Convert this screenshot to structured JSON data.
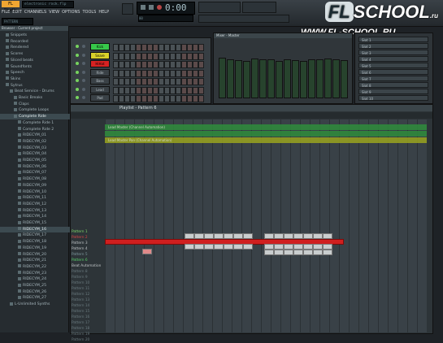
{
  "app": {
    "title": "FL Studio",
    "project_name": "electronic rock.flp",
    "time_display": "0:00",
    "time_sub": "00",
    "hint_label": "PATTERN"
  },
  "menu": [
    "FILE",
    "EDIT",
    "CHANNELS",
    "VIEW",
    "OPTIONS",
    "TOOLS",
    "HELP"
  ],
  "logo": {
    "fl": "FL",
    "school": "SCHOOL",
    "domain_suffix": ".ru",
    "url": "WWW.FL-SCHOOL.RU"
  },
  "browser": {
    "title": "Browser - Current project",
    "items": [
      {
        "label": "Snippets",
        "indent": 1
      },
      {
        "label": "Recorded",
        "indent": 1
      },
      {
        "label": "Rendered",
        "indent": 1
      },
      {
        "label": "Scores",
        "indent": 1
      },
      {
        "label": "Sliced beats",
        "indent": 1
      },
      {
        "label": "Soundfonts",
        "indent": 1
      },
      {
        "label": "Speech",
        "indent": 1
      },
      {
        "label": "Skins",
        "indent": 1
      },
      {
        "label": "Sytrus",
        "indent": 1
      },
      {
        "label": "Beat Service - Drums",
        "indent": 2
      },
      {
        "label": "Basic Breaks",
        "indent": 3
      },
      {
        "label": "Claps",
        "indent": 3
      },
      {
        "label": "Complete Loops",
        "indent": 3
      },
      {
        "label": "Complete Ride",
        "indent": 3,
        "selected": true
      },
      {
        "label": "Complete Ride 1",
        "indent": 4
      },
      {
        "label": "Complete Ride 2",
        "indent": 4
      },
      {
        "label": "RIDECYM_01",
        "indent": 4
      },
      {
        "label": "RIDECYM_02",
        "indent": 4
      },
      {
        "label": "RIDECYM_03",
        "indent": 4
      },
      {
        "label": "RIDECYM_04",
        "indent": 4
      },
      {
        "label": "RIDECYM_05",
        "indent": 4
      },
      {
        "label": "RIDECYM_06",
        "indent": 4
      },
      {
        "label": "RIDECYM_07",
        "indent": 4
      },
      {
        "label": "RIDECYM_08",
        "indent": 4
      },
      {
        "label": "RIDECYM_09",
        "indent": 4
      },
      {
        "label": "RIDECYM_10",
        "indent": 4
      },
      {
        "label": "RIDECYM_11",
        "indent": 4
      },
      {
        "label": "RIDECYM_12",
        "indent": 4
      },
      {
        "label": "RIDECYM_13",
        "indent": 4
      },
      {
        "label": "RIDECYM_14",
        "indent": 4
      },
      {
        "label": "RIDECYM_15",
        "indent": 4
      },
      {
        "label": "RIDECYM_16",
        "indent": 4,
        "selected": true
      },
      {
        "label": "RIDECYM_17",
        "indent": 4
      },
      {
        "label": "RIDECYM_18",
        "indent": 4
      },
      {
        "label": "RIDECYM_19",
        "indent": 4
      },
      {
        "label": "RIDECYM_20",
        "indent": 4
      },
      {
        "label": "RIDECYM_21",
        "indent": 4
      },
      {
        "label": "RIDECYM_22",
        "indent": 4
      },
      {
        "label": "RIDECYM_23",
        "indent": 4
      },
      {
        "label": "RIDECYM_24",
        "indent": 4
      },
      {
        "label": "RIDECYM_25",
        "indent": 4
      },
      {
        "label": "RIDECYM_26",
        "indent": 4
      },
      {
        "label": "RIDECYM_27",
        "indent": 4
      },
      {
        "label": "L-Unlimited Synths",
        "indent": 2
      }
    ]
  },
  "channels": [
    {
      "name": "Kick",
      "color": "#37c84a"
    },
    {
      "name": "Snare",
      "color": "#d9d12a"
    },
    {
      "name": "HiHat",
      "color": "#d62222"
    },
    {
      "name": "Ride",
      "color": "#3a4146"
    },
    {
      "name": "Bass",
      "color": "#3a4146"
    },
    {
      "name": "Lead",
      "color": "#3a4146"
    },
    {
      "name": "Pad",
      "color": "#3a4146"
    }
  ],
  "mixer": {
    "title": "Mixer - Master",
    "fader_levels": [
      0.72,
      0.7,
      0.68,
      0.66,
      0.71,
      0.69,
      0.7,
      0.67,
      0.7,
      0.68,
      0.66,
      0.7,
      0.69,
      0.71,
      0.7,
      0.68
    ]
  },
  "plugins": {
    "slots": [
      "Slot 1",
      "Slot 2",
      "Slot 3",
      "Slot 4",
      "Slot 5",
      "Slot 6",
      "Slot 7",
      "Slot 8",
      "Slot 9",
      "Slot 10"
    ]
  },
  "playlist": {
    "title": "Playlist - Pattern 6",
    "tracks_top": [
      {
        "label": "Audio Clip",
        "color": "#2f8d3c",
        "text": "Lead Master (Channel Automation)"
      },
      {
        "label": "",
        "color": "#2f8d3c",
        "text": ""
      },
      {
        "label": "",
        "color": "#9aa41f",
        "text": "Lead Master Pan (Channel Automation)"
      }
    ],
    "patterns": [
      {
        "label": "Pattern 1",
        "color": "#7fd96a"
      },
      {
        "label": "Pattern 2",
        "color": "#d94444"
      },
      {
        "label": "Pattern 3",
        "color": "#c0c5c7"
      },
      {
        "label": "Pattern 4",
        "color": "#c0c5c7"
      },
      {
        "label": "Pattern 5",
        "color": "#7f9a9f"
      },
      {
        "label": "Pattern 6",
        "color": "#59d06a"
      },
      {
        "label": "Beat Automation",
        "color": "#c0c5c7"
      },
      {
        "label": "Pattern 8",
        "color": "#6a7a7f"
      },
      {
        "label": "Pattern 9",
        "color": "#6a7a7f"
      },
      {
        "label": "Pattern 10",
        "color": "#6a7a7f"
      },
      {
        "label": "Pattern 11",
        "color": "#6a7a7f"
      },
      {
        "label": "Pattern 12",
        "color": "#6a7a7f"
      },
      {
        "label": "Pattern 13",
        "color": "#6a7a7f"
      },
      {
        "label": "Pattern 14",
        "color": "#6a7a7f"
      },
      {
        "label": "Pattern 15",
        "color": "#6a7a7f"
      },
      {
        "label": "Pattern 16",
        "color": "#6a7a7f"
      },
      {
        "label": "Pattern 17",
        "color": "#6a7a7f"
      },
      {
        "label": "Pattern 18",
        "color": "#6a7a7f"
      },
      {
        "label": "Pattern 19",
        "color": "#6a7a7f"
      },
      {
        "label": "Pattern 20",
        "color": "#6a7a7f"
      }
    ]
  }
}
